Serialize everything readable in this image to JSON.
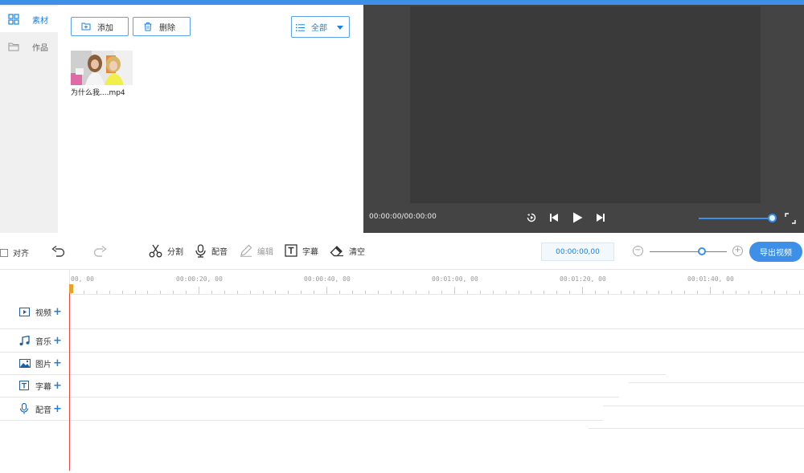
{
  "nav": {
    "items": [
      {
        "label": "素材",
        "icon": "grid-icon",
        "active": true
      },
      {
        "label": "作品",
        "icon": "folder-icon",
        "active": false
      }
    ]
  },
  "material": {
    "add_label": "添加",
    "delete_label": "删除",
    "filter_value": "全部",
    "clips": [
      {
        "name": "为什么我....mp4"
      }
    ]
  },
  "player": {
    "time": "00:00:00/00:00:00",
    "volume_level": 1.0
  },
  "toolbar": {
    "align_label": "对齐",
    "split_label": "分割",
    "dub_label": "配音",
    "edit_label": "编辑",
    "subtitle_label": "字幕",
    "clear_label": "清空",
    "timecode": "00:00:00,00",
    "export_label": "导出视频",
    "zoom_level": 0.64
  },
  "timeline": {
    "ruler_labels": [
      "00, 00",
      "00:00:20, 00",
      "00:00:40, 00",
      "00:01:00, 00",
      "00:01:20, 00",
      "00:01:40, 00"
    ],
    "tracks": [
      {
        "label": "视频",
        "icon": "video-icon"
      },
      {
        "label": "音乐",
        "icon": "music-icon"
      },
      {
        "label": "图片",
        "icon": "image-icon"
      },
      {
        "label": "字幕",
        "icon": "text-icon"
      },
      {
        "label": "配音",
        "icon": "microphone-icon"
      }
    ],
    "add_symbol": "+"
  },
  "colors": {
    "accent": "#3d8fe8",
    "playhead": "#e04848",
    "player_bg": "#444444"
  }
}
